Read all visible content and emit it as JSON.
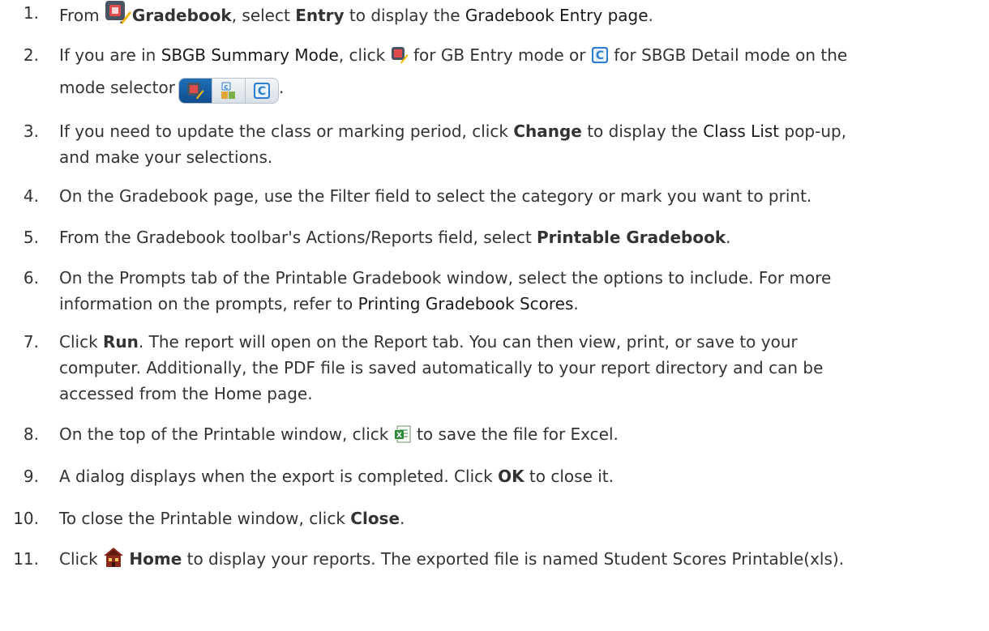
{
  "steps": [
    {
      "number": "1.",
      "parts": {
        "a": "From ",
        "gradebook_icon": "gradebook-entry-icon",
        "b": "Gradebook",
        "c": ", select ",
        "d": "Entry",
        "e": " to display the ",
        "f": "Gradebook Entry page",
        "g": "."
      }
    },
    {
      "number": "2.",
      "parts": {
        "a": "If you are in ",
        "b": "SBGB Summary Mode",
        "c": ", click ",
        "d": " for GB Entry mode or ",
        "e": " for SBGB Detail mode on the",
        "f": "mode selector",
        "g": "."
      }
    },
    {
      "number": "3.",
      "parts": {
        "a": "If you need to update the class or marking period, click ",
        "b": "Change",
        "c": " to display the ",
        "d": "Class List",
        "e": " pop-up,",
        "f": "and make your selections."
      }
    },
    {
      "number": "4.",
      "text": "On the Gradebook page, use the Filter field to select the category or mark you want to print."
    },
    {
      "number": "5.",
      "parts": {
        "a": "From the Gradebook toolbar's Actions/Reports field, select ",
        "b": "Printable Gradebook",
        "c": "."
      }
    },
    {
      "number": "6.",
      "parts": {
        "a": "On the Prompts tab of the Printable Gradebook window, select the options to include. For more",
        "b": "information on the prompts, refer to ",
        "c": "Printing Gradebook Scores",
        "d": "."
      }
    },
    {
      "number": "7.",
      "parts": {
        "a": "Click ",
        "b": "Run",
        "c": ". The report will open on the Report tab. You can then view, print, or save to your",
        "d": "computer. Additionally, the PDF file is saved automatically to your report directory and can be",
        "e": "accessed from the Home page."
      }
    },
    {
      "number": "8.",
      "parts": {
        "a": "On the top of the Printable window, click ",
        "b": " to save the file for Excel."
      }
    },
    {
      "number": "9.",
      "parts": {
        "a": "A dialog displays when the export is completed. Click ",
        "b": "OK",
        "c": " to close it."
      }
    },
    {
      "number": "10.",
      "parts": {
        "a": "To close the Printable window, click ",
        "b": "Close",
        "c": "."
      }
    },
    {
      "number": "11.",
      "parts": {
        "a": "Click ",
        "b": "Home",
        "c": " to display your reports. The exported file is named Student Scores Printable(xls)."
      }
    }
  ],
  "icons": {
    "gradebook": "gradebook-entry-icon",
    "gb_entry_mode": "gb-entry-mode-icon",
    "sbgb_detail_mode": "sbgb-detail-mode-icon",
    "sbgb_summary_mode": "sbgb-summary-mode-icon",
    "excel_export": "excel-export-icon",
    "home": "home-icon"
  },
  "colors": {
    "text": "#333333",
    "mode_selector_active": "#1f6fb8",
    "icon_blue": "#2f7fd1",
    "excel_green": "#2e8b3a",
    "home_red": "#8b2b1d"
  }
}
